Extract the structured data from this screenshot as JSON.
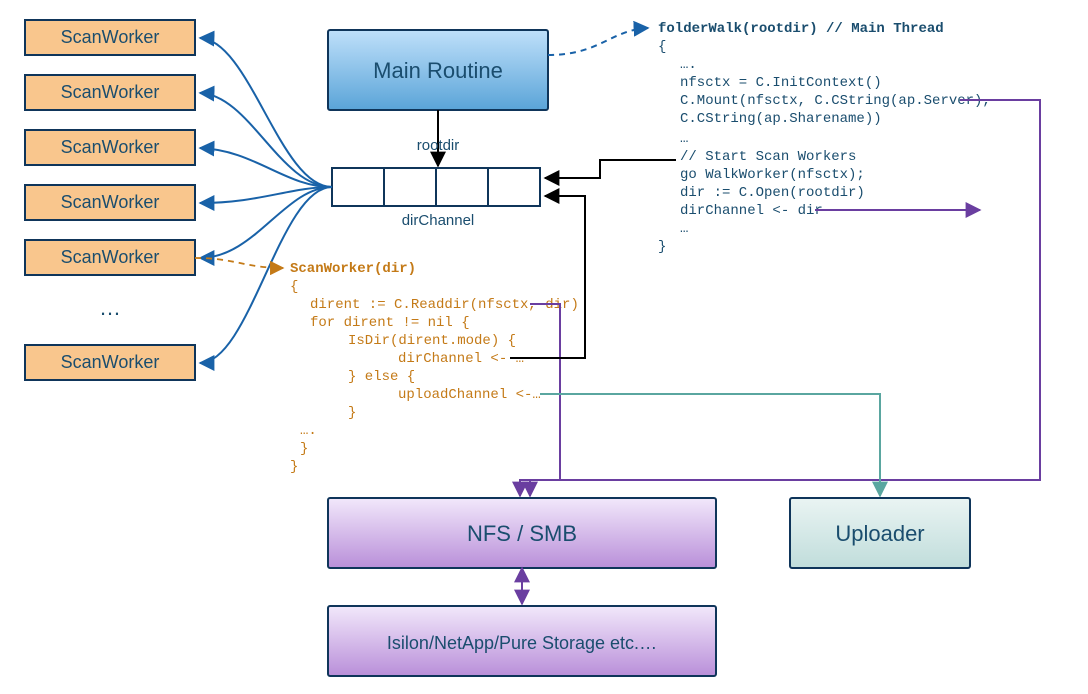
{
  "main_routine": "Main Routine",
  "rootdir_label": "rootdir",
  "dirchannel_label": "dirChannel",
  "scanworkers": [
    "ScanWorker",
    "ScanWorker",
    "ScanWorker",
    "ScanWorker",
    "ScanWorker",
    "ScanWorker"
  ],
  "ellipsis": "…",
  "nfs_box": "NFS / SMB",
  "uploader_box": "Uploader",
  "storage_box": "Isilon/NetApp/Pure Storage etc.…",
  "main_code": {
    "sig": "folderWalk(rootdir) // Main Thread",
    "l1": "{",
    "l2": "….",
    "l3": "nfsctx = C.InitContext()",
    "l4": "C.Mount(nfsctx, C.CString(ap.Server),",
    "l5": "      C.CString(ap.Sharename))",
    "l6": "…",
    "l7": "// Start Scan Workers",
    "l8": "go WalkWorker(nfsctx);",
    "l9": "dir := C.Open(rootdir)",
    "l10": "dirChannel <- dir",
    "l11": "…",
    "l12": "}"
  },
  "worker_code": {
    "sig": "ScanWorker(dir)",
    "l1": "{",
    "l2": "dirent := C.Readdir(nfsctx, dir)",
    "l3": "for dirent != nil {",
    "l4": "IsDir(dirent.mode) {",
    "l5": "dirChannel <- …",
    "l6": "} else {",
    "l7": "uploadChannel <-…",
    "l8": "}",
    "l9": "….",
    "l10": "}",
    "l11": "}"
  }
}
